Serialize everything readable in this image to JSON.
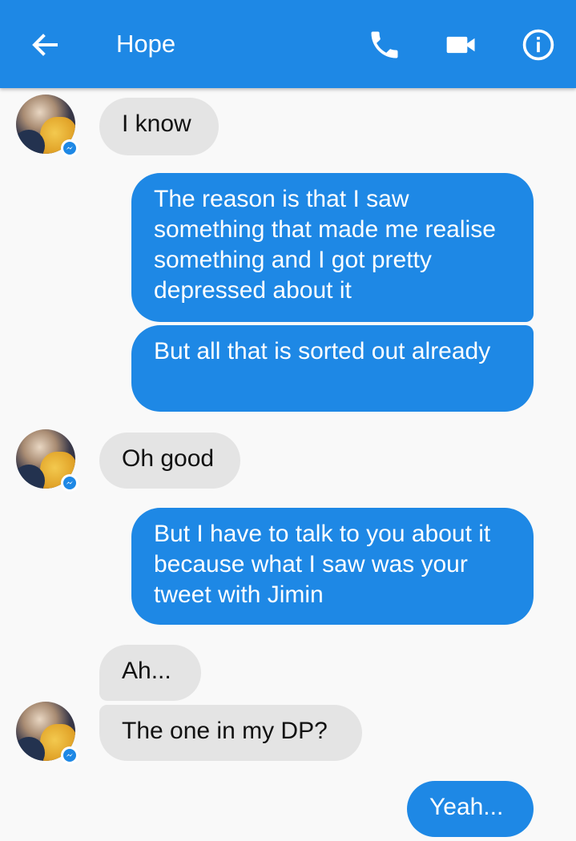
{
  "header": {
    "title": "Hope",
    "back_icon": "arrow-left-icon",
    "call_icon": "phone-icon",
    "video_icon": "video-camera-icon",
    "info_icon": "info-icon",
    "background": "#1e88e5"
  },
  "messages": [
    {
      "side": "in",
      "text": "I know"
    },
    {
      "side": "out",
      "text": "The reason is that I saw something that made me realise something and I got pretty depressed about it"
    },
    {
      "side": "out",
      "text": "But all that is sorted out already"
    },
    {
      "side": "in",
      "text": "Oh good"
    },
    {
      "side": "out",
      "text": "But I have to talk to you about it because what I saw was your tweet with Jimin"
    },
    {
      "side": "in",
      "text": "Ah..."
    },
    {
      "side": "in",
      "text": "The one in my DP?"
    },
    {
      "side": "out",
      "text": "Yeah..."
    }
  ],
  "colors": {
    "outgoing_bubble": "#1e88e5",
    "incoming_bubble": "#e4e4e4",
    "messenger_badge": "#1e88e5"
  }
}
